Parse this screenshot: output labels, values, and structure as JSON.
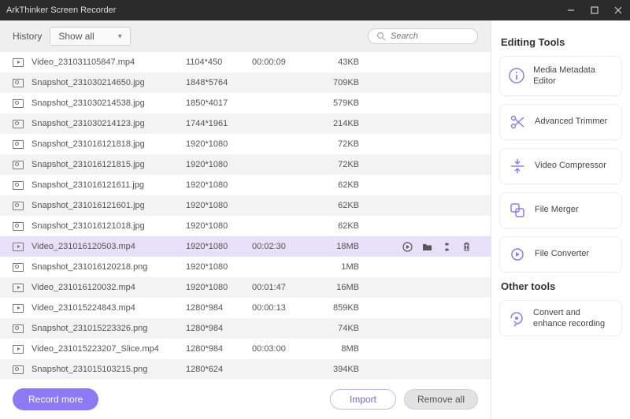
{
  "app": {
    "title": "ArkThinker Screen Recorder"
  },
  "subheader": {
    "history_label": "History",
    "filter_label": "Show all",
    "search_placeholder": "Search"
  },
  "files": [
    {
      "type": "video",
      "name": "Video_231031105847.mp4",
      "res": "1104*450",
      "dur": "00:00:09",
      "size": "43KB",
      "selected": false
    },
    {
      "type": "image",
      "name": "Snapshot_231030214650.jpg",
      "res": "1848*5764",
      "dur": "",
      "size": "709KB",
      "selected": false
    },
    {
      "type": "image",
      "name": "Snapshot_231030214538.jpg",
      "res": "1850*4017",
      "dur": "",
      "size": "579KB",
      "selected": false
    },
    {
      "type": "image",
      "name": "Snapshot_231030214123.jpg",
      "res": "1744*1961",
      "dur": "",
      "size": "214KB",
      "selected": false
    },
    {
      "type": "image",
      "name": "Snapshot_231016121818.jpg",
      "res": "1920*1080",
      "dur": "",
      "size": "72KB",
      "selected": false
    },
    {
      "type": "image",
      "name": "Snapshot_231016121815.jpg",
      "res": "1920*1080",
      "dur": "",
      "size": "72KB",
      "selected": false
    },
    {
      "type": "image",
      "name": "Snapshot_231016121611.jpg",
      "res": "1920*1080",
      "dur": "",
      "size": "62KB",
      "selected": false
    },
    {
      "type": "image",
      "name": "Snapshot_231016121601.jpg",
      "res": "1920*1080",
      "dur": "",
      "size": "62KB",
      "selected": false
    },
    {
      "type": "image",
      "name": "Snapshot_231016121018.jpg",
      "res": "1920*1080",
      "dur": "",
      "size": "62KB",
      "selected": false
    },
    {
      "type": "video",
      "name": "Video_231016120503.mp4",
      "res": "1920*1080",
      "dur": "00:02:30",
      "size": "18MB",
      "selected": true
    },
    {
      "type": "image",
      "name": "Snapshot_231016120218.png",
      "res": "1920*1080",
      "dur": "",
      "size": "1MB",
      "selected": false
    },
    {
      "type": "video",
      "name": "Video_231016120032.mp4",
      "res": "1920*1080",
      "dur": "00:01:47",
      "size": "16MB",
      "selected": false
    },
    {
      "type": "video",
      "name": "Video_231015224843.mp4",
      "res": "1280*984",
      "dur": "00:00:13",
      "size": "859KB",
      "selected": false
    },
    {
      "type": "image",
      "name": "Snapshot_231015223326.png",
      "res": "1280*984",
      "dur": "",
      "size": "74KB",
      "selected": false
    },
    {
      "type": "video",
      "name": "Video_231015223207_Slice.mp4",
      "res": "1280*984",
      "dur": "00:03:00",
      "size": "8MB",
      "selected": false
    },
    {
      "type": "image",
      "name": "Snapshot_231015103215.png",
      "res": "1280*624",
      "dur": "",
      "size": "394KB",
      "selected": false
    }
  ],
  "footer": {
    "record_label": "Record more",
    "import_label": "Import",
    "remove_label": "Remove all"
  },
  "sidebar": {
    "editing_title": "Editing Tools",
    "other_title": "Other tools",
    "tools": [
      {
        "icon": "info",
        "label": "Media Metadata Editor"
      },
      {
        "icon": "scissors",
        "label": "Advanced Trimmer"
      },
      {
        "icon": "compress",
        "label": "Video Compressor"
      },
      {
        "icon": "merge",
        "label": "File Merger"
      },
      {
        "icon": "convert",
        "label": "File Converter"
      }
    ],
    "other": [
      {
        "icon": "enhance",
        "label": "Convert and enhance recording"
      }
    ]
  }
}
